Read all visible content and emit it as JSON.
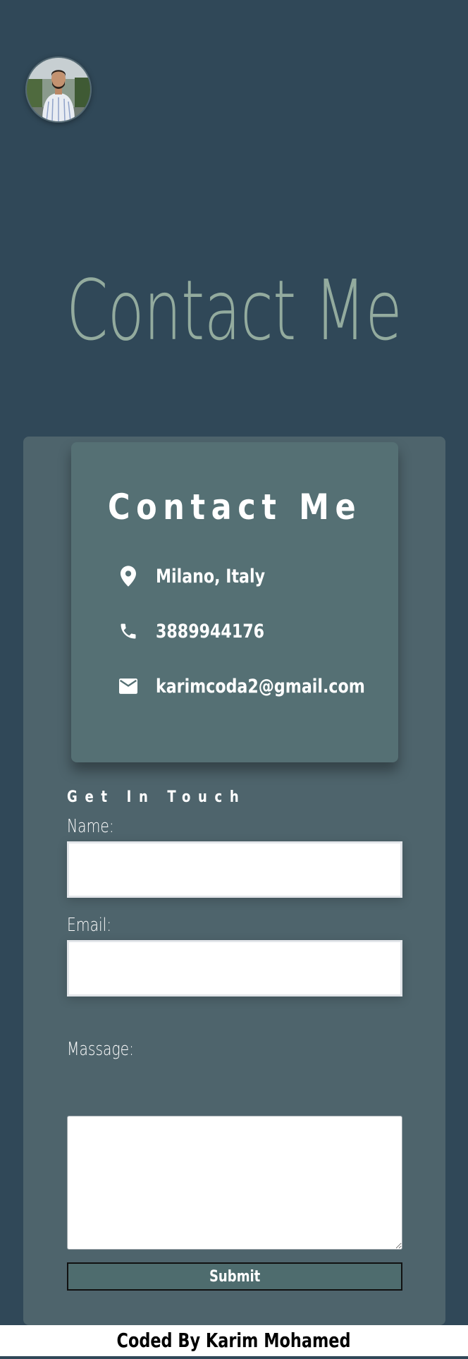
{
  "header": {
    "avatar_icon": "profile-photo",
    "title": "Contact Me"
  },
  "contact_card": {
    "title": "Contact Me",
    "items": [
      {
        "icon": "location-pin-icon",
        "text": "Milano, Italy"
      },
      {
        "icon": "phone-icon",
        "text": "3889944176"
      },
      {
        "icon": "mail-icon",
        "text": "karimcoda2@gmail.com"
      }
    ]
  },
  "form": {
    "heading": "Get In Touch",
    "name_label": "Name:",
    "name_value": "",
    "email_label": "Email:",
    "email_value": "",
    "message_label": "Massage:",
    "message_value": "",
    "submit_label": "Submit"
  },
  "footer": {
    "text": "Coded By Karim Mohamed"
  },
  "colors": {
    "background": "#304858",
    "panel": "#4e646c",
    "card": "#557074",
    "title_accent": "#93ab9e",
    "button": "#4e6c6e"
  }
}
